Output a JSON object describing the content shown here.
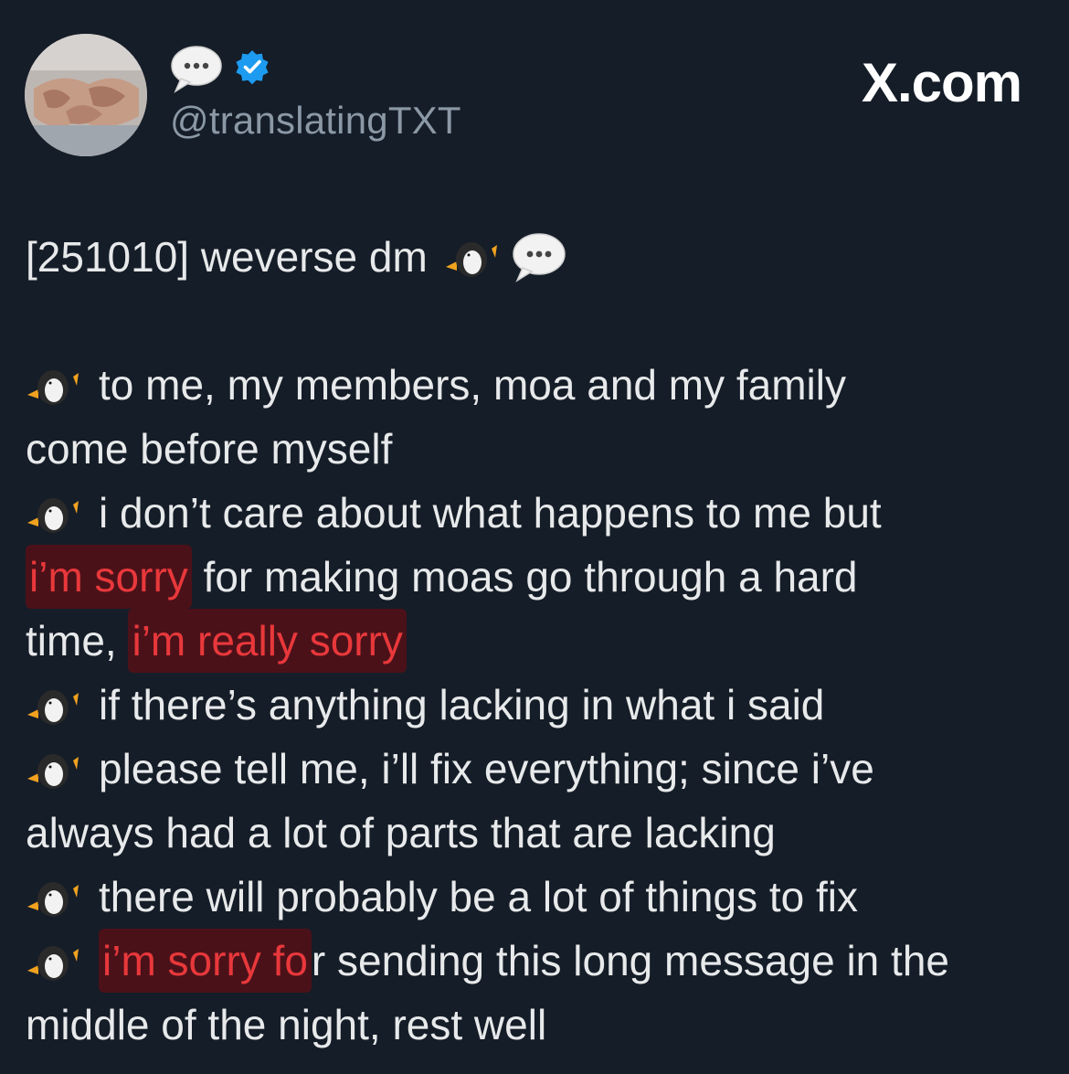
{
  "header": {
    "display_name_icon": "speech-bubble-emoji",
    "verified_icon": "verified-badge-icon",
    "handle": "@translatingTXT",
    "watermark": "X.com"
  },
  "colors": {
    "background": "#151d28",
    "text": "#e7e9ea",
    "handle": "#8b98a5",
    "verified": "#1d9bf0",
    "highlight_text": "#e8383b"
  },
  "tweet": {
    "title_text": "[251010] weverse dm",
    "title_icons": [
      "penguin-emoji",
      "speech-bubble-emoji"
    ],
    "lines": [
      {
        "icon": "penguin-emoji",
        "text": "to me, my members, moa and my family"
      },
      {
        "text": "come before myself"
      },
      {
        "icon": "penguin-emoji",
        "text": "i don’t care about what happens to me but"
      },
      {
        "highlight": "i’m sorry",
        "text": " for making moas go through a hard"
      },
      {
        "text": "time, ",
        "highlight": "i’m really sorry"
      },
      {
        "icon": "penguin-emoji",
        "text": "if there’s anything lacking in what i said"
      },
      {
        "icon": "penguin-emoji",
        "text": "please tell me, i’ll fix everything; since i’ve"
      },
      {
        "text": "always had a lot of parts that are lacking"
      },
      {
        "icon": "penguin-emoji",
        "text": "there will probably be a lot of things to fix"
      },
      {
        "icon": "penguin-emoji",
        "highlight": "i’m sorry fo",
        "text": "r sending this long message in the"
      },
      {
        "text": "middle of the night, rest well"
      }
    ]
  }
}
